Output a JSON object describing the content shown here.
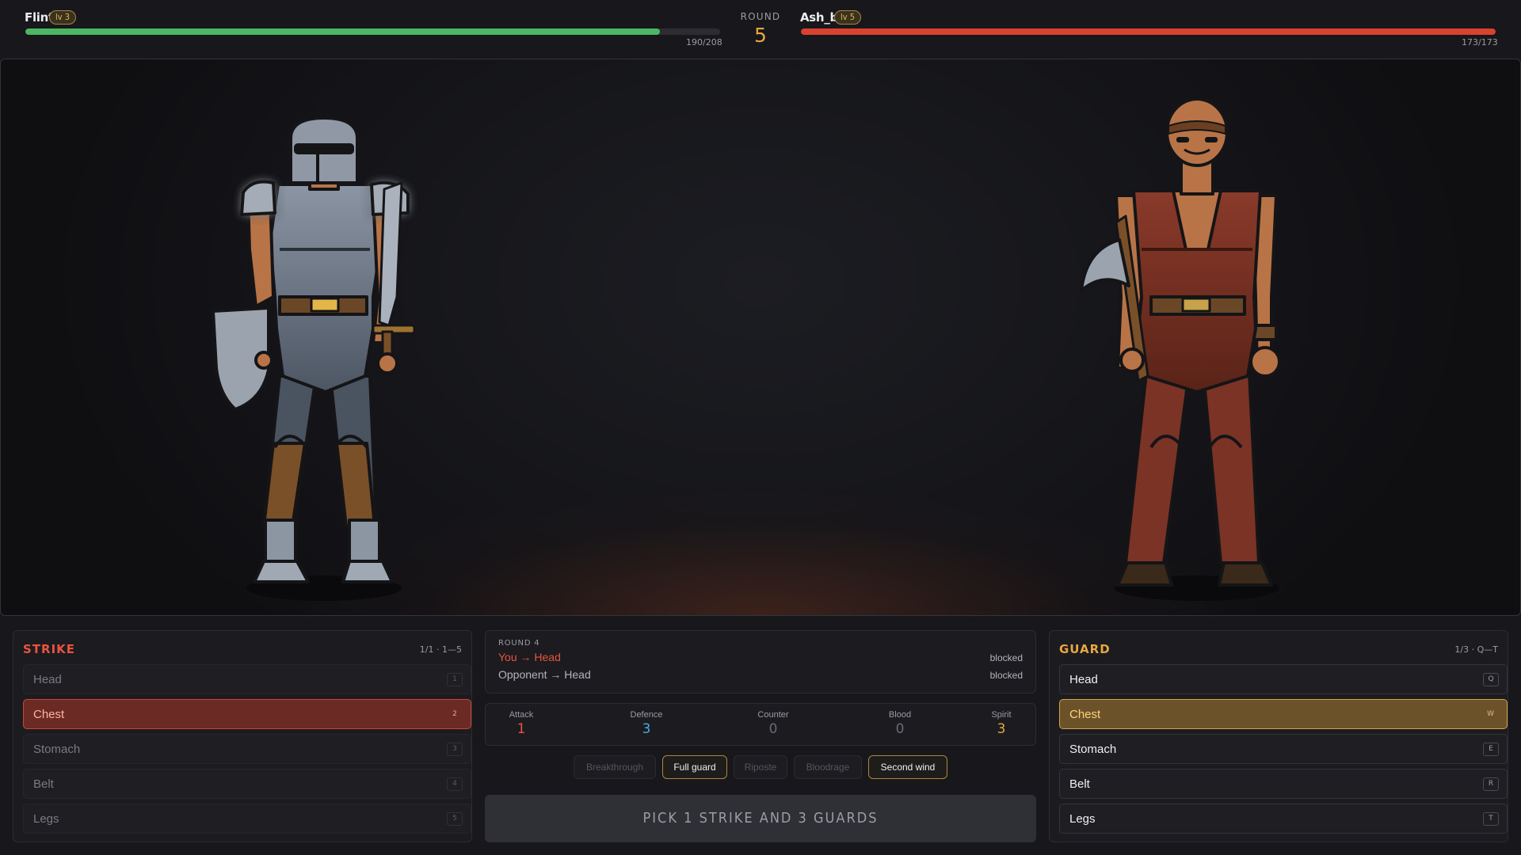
{
  "player": {
    "name": "Flint",
    "level": "lv 3",
    "hp_text": "190/208",
    "hp_fraction": 0.9135,
    "bar_color": "#4cb763"
  },
  "round": {
    "label": "ROUND",
    "number": "5"
  },
  "opponent": {
    "name": "Ash_bs",
    "level": "lv 5",
    "hp_text": "173/173",
    "hp_fraction": 1.0,
    "bar_color": "#d9422f"
  },
  "strike": {
    "title": "STRIKE",
    "meta": "1/1 · 1—5",
    "options": [
      {
        "label": "Head",
        "key": "1",
        "selected": false
      },
      {
        "label": "Chest",
        "key": "2",
        "selected": true
      },
      {
        "label": "Stomach",
        "key": "3",
        "selected": false
      },
      {
        "label": "Belt",
        "key": "4",
        "selected": false
      },
      {
        "label": "Legs",
        "key": "5",
        "selected": false
      }
    ]
  },
  "guard": {
    "title": "GUARD",
    "meta": "1/3 · Q—T",
    "options": [
      {
        "label": "Head",
        "key": "Q",
        "selected": false
      },
      {
        "label": "Chest",
        "key": "W",
        "selected": true
      },
      {
        "label": "Stomach",
        "key": "E",
        "selected": false
      },
      {
        "label": "Belt",
        "key": "R",
        "selected": false
      },
      {
        "label": "Legs",
        "key": "T",
        "selected": false
      }
    ]
  },
  "log": {
    "round_label": "ROUND 4",
    "you_line": "You → Head",
    "you_result": "blocked",
    "opponent_line": "Opponent → Head",
    "opponent_result": "blocked"
  },
  "stats": [
    {
      "label": "Attack",
      "value": "1",
      "color": "#e9533f"
    },
    {
      "label": "Defence",
      "value": "3",
      "color": "#4aa8e8"
    },
    {
      "label": "Counter",
      "value": "0",
      "color": "#6a6a72"
    },
    {
      "label": "Blood",
      "value": "0",
      "color": "#6a6a72"
    },
    {
      "label": "Spirit",
      "value": "3",
      "color": "#e7a640"
    }
  ],
  "abilities": [
    {
      "label": "Breakthrough",
      "active": false
    },
    {
      "label": "Full guard",
      "active": true
    },
    {
      "label": "Riposte",
      "active": false
    },
    {
      "label": "Bloodrage",
      "active": false
    },
    {
      "label": "Second wind",
      "active": true
    }
  ],
  "cta": {
    "label": "PICK 1 STRIKE AND 3 GUARDS"
  },
  "colors": {
    "strike_accent": "#e9533f",
    "guard_accent": "#e7a640"
  }
}
